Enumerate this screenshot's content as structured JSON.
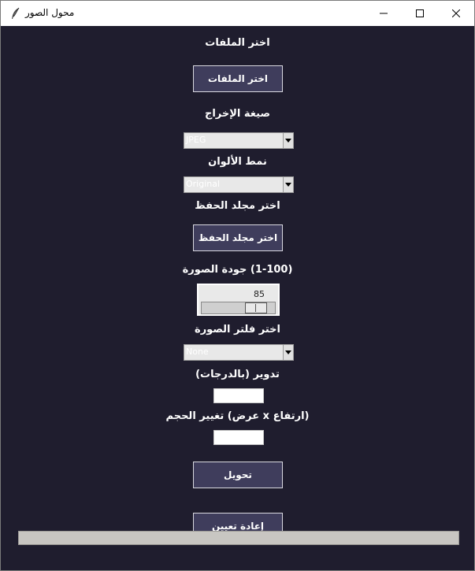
{
  "window": {
    "title": "محول الصور"
  },
  "labels": {
    "select_files": "اختر الملفات",
    "output_format": "صيغة الإخراج",
    "color_mode": "نمط الألوان",
    "save_folder": "اختر مجلد الحفظ",
    "quality": "(1-100) جودة الصورة",
    "filter": "اختر فلتر الصورة",
    "rotate": "تدوير (بالدرجات)",
    "resize": "(ارتفاع x عرض) تغيير الحجم"
  },
  "buttons": {
    "select_files": "اختر الملفات",
    "save_folder": "اختر مجلد الحفظ",
    "convert": "تحويل",
    "reset": "إعادة تعيين"
  },
  "combos": {
    "format": "JPEG",
    "color_mode": "Original",
    "filter": "None"
  },
  "quality": {
    "value": "85",
    "fraction": 0.85
  },
  "inputs": {
    "rotate": "",
    "resize": ""
  },
  "progress": {
    "value": 0
  },
  "colors": {
    "background": "#1f1d2e",
    "button": "#3f3d5c",
    "text": "#ffffff"
  }
}
